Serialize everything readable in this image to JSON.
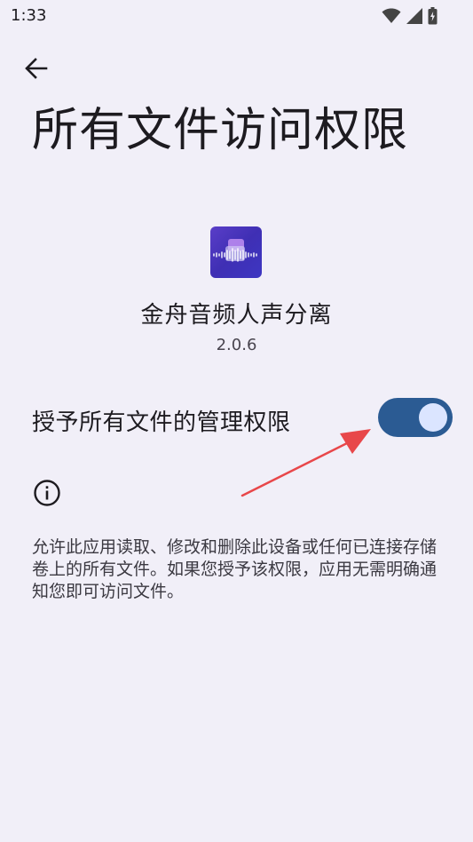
{
  "status_bar": {
    "time": "1:33"
  },
  "page": {
    "title": "所有文件访问权限"
  },
  "app": {
    "name": "金舟音频人声分离",
    "version": "2.0.6"
  },
  "permission": {
    "label": "授予所有文件的管理权限",
    "enabled": true
  },
  "info": {
    "description": "允许此应用读取、修改和删除此设备或任何已连接存储卷上的所有文件。如果您授予该权限，应用无需明确通知您即可访问文件。"
  },
  "colors": {
    "background": "#f1eff8",
    "toggle_track": "#2b5b93",
    "toggle_thumb": "#dbe5ff",
    "annotation_arrow": "#e8474a",
    "app_icon": "#4a37c0"
  },
  "icons": {
    "back": "back-arrow-icon",
    "wifi": "wifi-icon",
    "signal": "signal-icon",
    "battery": "battery-charging-icon",
    "info": "info-icon"
  }
}
